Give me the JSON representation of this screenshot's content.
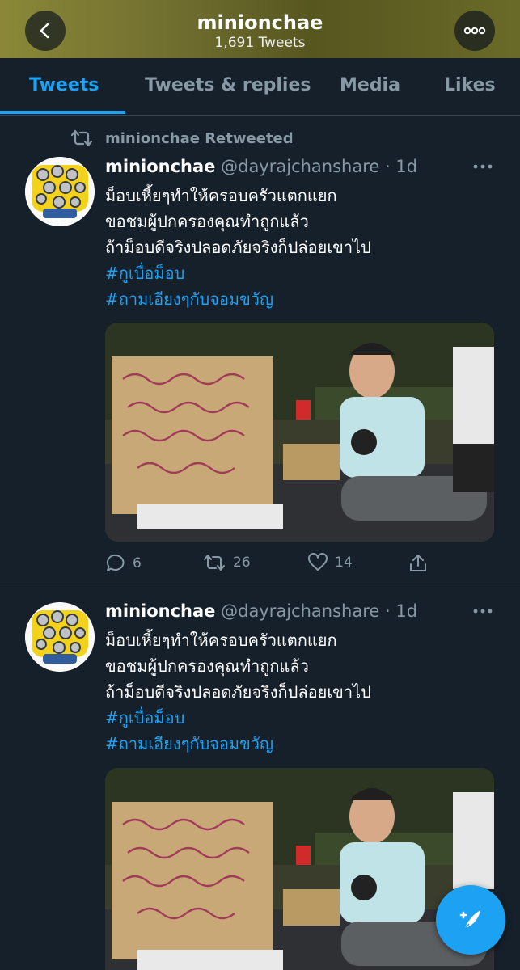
{
  "header": {
    "title": "minionchae",
    "tweet_count": "1,691 Tweets"
  },
  "tabs": [
    {
      "label": "Tweets",
      "active": true
    },
    {
      "label": "Tweets & replies",
      "active": false
    },
    {
      "label": "Media",
      "active": false
    },
    {
      "label": "Likes",
      "active": false
    }
  ],
  "tweets": [
    {
      "retweeted_by": "minionchae Retweeted",
      "name": "minionchae",
      "handle_time": "@dayrajchanshare · 1d",
      "lines": [
        "ม็อบเหี้ยๆทำให้ครอบครัวแตกแยก",
        "ขอชมผู้ปกครองคุณทำถูกแล้ว",
        "ถ้าม็อบดีจริงปลอดภัยจริงก็ปล่อยเขาไป"
      ],
      "hashtags": [
        "#กูเบื่อม็อบ",
        "#ถามเอียงๆกับจอมขวัญ"
      ],
      "media_icon": "protest-photo",
      "replies": "6",
      "retweets": "26",
      "likes": "14"
    },
    {
      "name": "minionchae",
      "handle_time": "@dayrajchanshare · 1d",
      "lines": [
        "ม็อบเหี้ยๆทำให้ครอบครัวแตกแยก",
        "ขอชมผู้ปกครองคุณทำถูกแล้ว",
        "ถ้าม็อบดีจริงปลอดภัยจริงก็ปล่อยเขาไป"
      ],
      "hashtags": [
        "#กูเบื่อม็อบ",
        "#ถามเอียงๆกับจอมขวัญ"
      ],
      "media_icon": "protest-photo"
    }
  ],
  "colors": {
    "background": "#15202b",
    "accent": "#1da1f2",
    "secondary_text": "#8899a6",
    "divider": "#38444d"
  }
}
